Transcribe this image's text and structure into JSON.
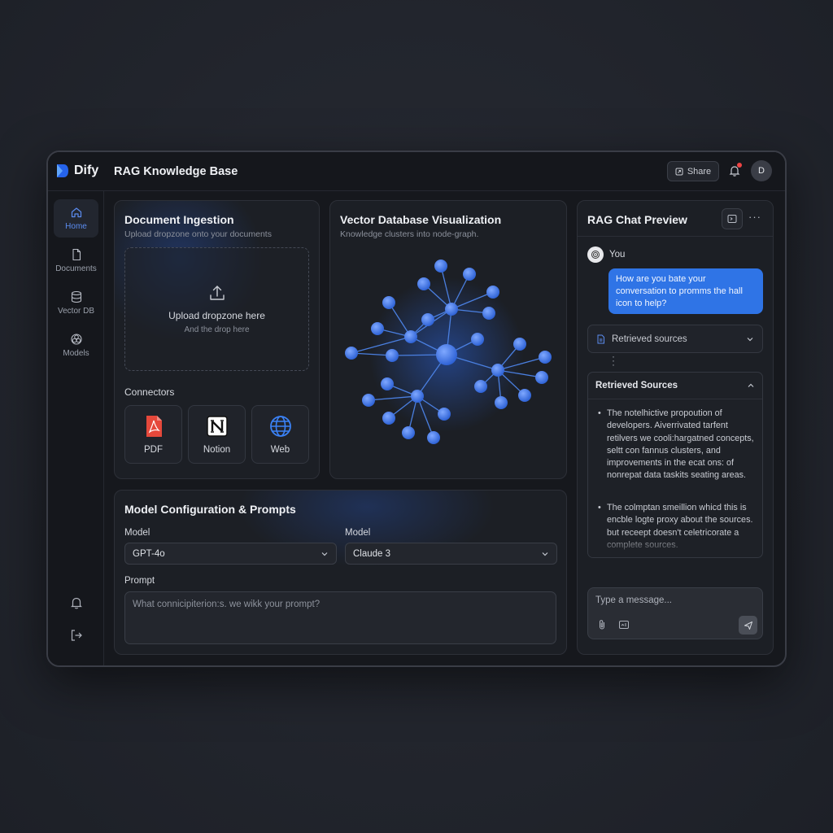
{
  "app": {
    "brand": "Dify",
    "title": "RAG Knowledge Base"
  },
  "header": {
    "share_label": "Share",
    "avatar_initial": "D"
  },
  "sidebar": {
    "items": [
      {
        "label": "Home",
        "icon": "home-icon"
      },
      {
        "label": "Documents",
        "icon": "document-icon"
      },
      {
        "label": "Vector DB",
        "icon": "database-icon"
      },
      {
        "label": "Models",
        "icon": "models-icon"
      }
    ]
  },
  "ingestion": {
    "title": "Document Ingestion",
    "subtitle": "Upload dropzone onto your documents",
    "dropzone_main": "Upload dropzone here",
    "dropzone_sub": "And the drop here",
    "connectors_label": "Connectors",
    "connectors": [
      {
        "label": "PDF",
        "icon": "pdf-icon"
      },
      {
        "label": "Notion",
        "icon": "notion-icon"
      },
      {
        "label": "Web",
        "icon": "globe-icon"
      }
    ]
  },
  "vector": {
    "title": "Vector Database Visualization",
    "subtitle": "Knowledge clusters into node-graph."
  },
  "model_config": {
    "title": "Model Configuration & Prompts",
    "model_label_1": "Model",
    "model_value_1": "GPT-4o",
    "model_label_2": "Model",
    "model_value_2": "Claude 3",
    "prompt_label": "Prompt",
    "prompt_placeholder": "What connicipiterion:s. we wikk your prompt?"
  },
  "chat": {
    "title": "RAG Chat Preview",
    "more": "···",
    "user_label": "You",
    "user_message": "How are you bate your conversation to promms the hall icon to help?",
    "sources_collapsed_label": "Retrieved sources",
    "sources_panel_title": "Retrieved Sources",
    "sources": [
      "The notelhictive propoution of developers. Aiverrivated tarfent retilvers we cooli:hargatned concepts, seltt con fannus clusters, and improvements in the ecat ons: of nonrepat data taskits seating areas.",
      "The colmptan smeillion whicd this is encble logte proxy about the sources. but receept doesn't celetricorate a complete sources."
    ],
    "composer_placeholder": "Type a message..."
  },
  "colors": {
    "accent": "#2f74e6",
    "node": "#3f7be8",
    "background": "#22252d",
    "panel": "#1c1f25"
  }
}
